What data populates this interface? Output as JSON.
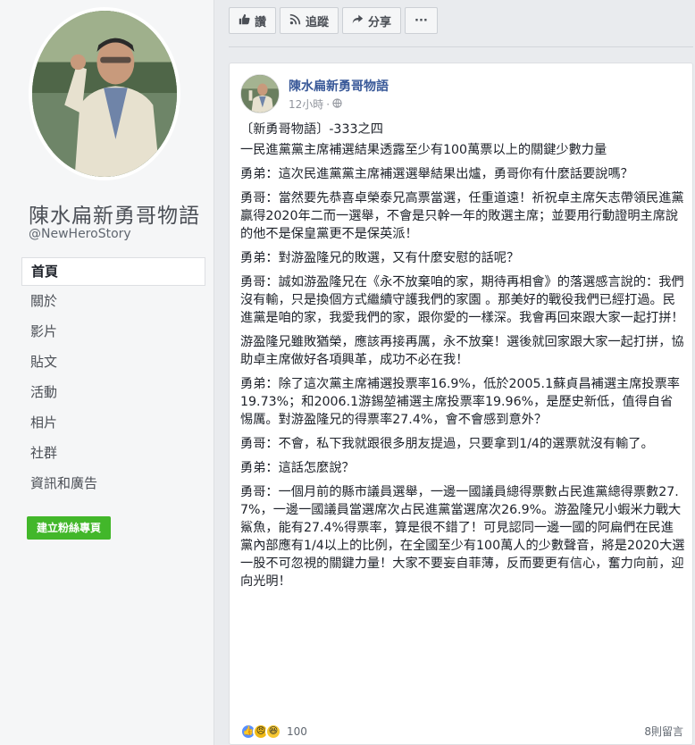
{
  "sidebar": {
    "page_name": "陳水扁新勇哥物語",
    "handle": "@NewHeroStory",
    "nav": [
      {
        "label": "首頁",
        "active": true
      },
      {
        "label": "關於"
      },
      {
        "label": "影片"
      },
      {
        "label": "貼文"
      },
      {
        "label": "活動"
      },
      {
        "label": "相片"
      },
      {
        "label": "社群"
      },
      {
        "label": "資訊和廣告"
      }
    ],
    "create_button": "建立粉絲專頁"
  },
  "actionbar": {
    "like": "讚",
    "follow": "追蹤",
    "share": "分享",
    "more": "···"
  },
  "post": {
    "author": "陳水扁新勇哥物語",
    "time": "12小時",
    "paragraphs": [
      "〔新勇哥物語〕-333之四",
      "一民進黨黨主席補選結果透露至少有100萬票以上的關鍵少數力量",
      "勇弟：這次民進黨黨主席補選選舉結果出爐，勇哥你有什麼話要說嗎？",
      "勇哥：當然要先恭喜卓榮泰兄高票當選，任重道遠！祈祝卓主席矢志帶領民進黨贏得2020年二而一選舉，不會是只幹一年的敗選主席；並要用行動證明主席說的他不是保皇黨更不是保英派！",
      "勇弟：對游盈隆兄的敗選，又有什麼安慰的話呢？",
      "勇哥：誠如游盈隆兄在《永不放棄咱的家，期待再相會》的落選感言說的：我們沒有輸，只是換個方式繼續守護我們的家園 。那美好的戰役我們已經打過。民進黨是咱的家，我愛我們的家，跟你愛的一樣深。我會再回來跟大家一起打拼！",
      "游盈隆兄雖敗猶榮，應該再接再厲，永不放棄！選後就回家跟大家一起打拼，協助卓主席做好各項興革，成功不必在我！",
      "勇弟：除了這次黨主席補選投票率16.9%，低於2005.1蘇貞昌補選主席投票率19.73%；和2006.1游錫堃補選主席投票率19.96%，是歷史新低，值得自省惕厲。對游盈隆兄的得票率27.4%，會不會感到意外？",
      "勇哥：不會，私下我就跟很多朋友提過，只要拿到1/4的選票就沒有輸了。",
      "勇弟：這話怎麼說？",
      "勇哥：一個月前的縣市議員選舉，一邊一國議員總得票數占民進黨總得票數27.7%，一邊一國議員當選席次占民進黨當選席次26.9%。游盈隆兄小蝦米力戰大鯊魚，能有27.4%得票率，算是很不錯了！可見認同一邊一國的阿扁們在民進黨內部應有1/4以上的比例，在全國至少有100萬人的少數聲音，將是2020大選一股不可忽視的關鍵力量！大家不要妄自菲薄，反而要更有信心，奮力向前，迎向光明！"
    ],
    "reaction_count": "100",
    "comment_count": "8則留言"
  }
}
